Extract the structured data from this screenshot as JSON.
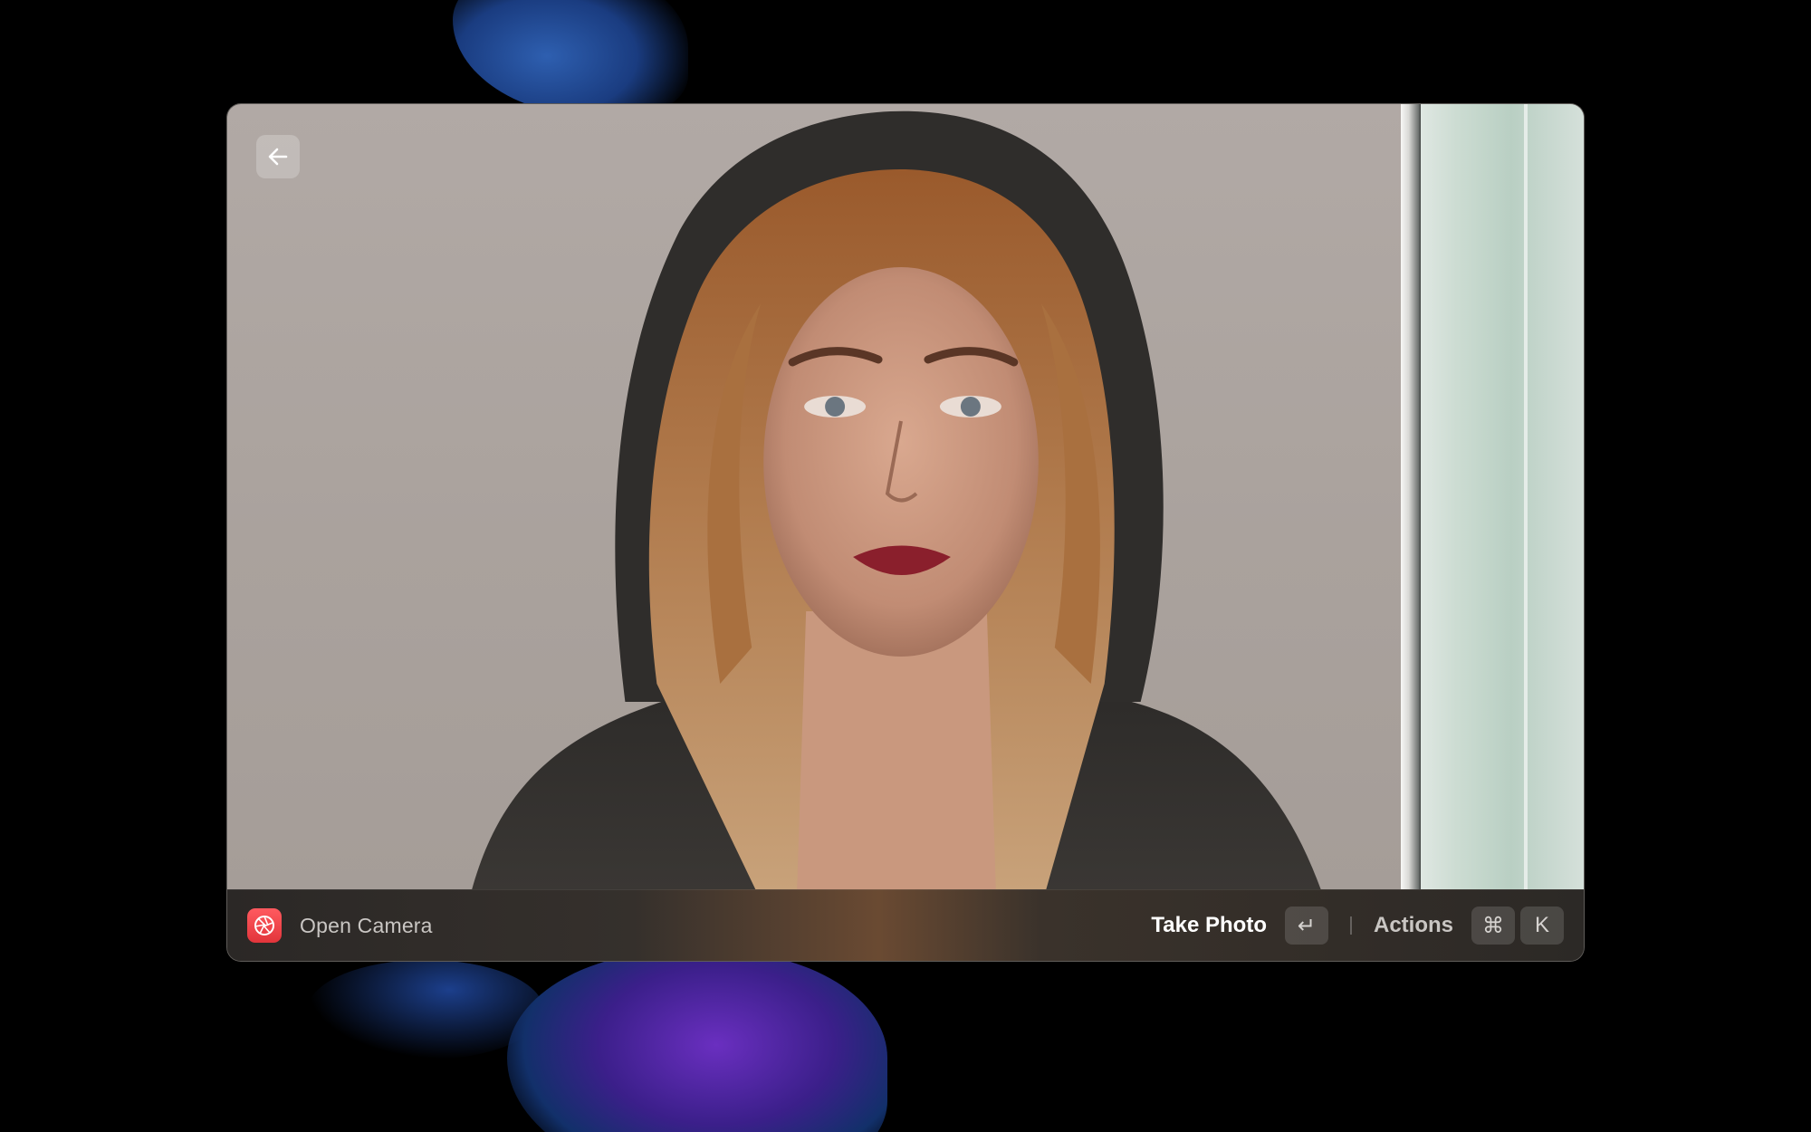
{
  "window": {
    "back_icon": "arrow-left-icon"
  },
  "action_bar": {
    "app_icon": "aperture-icon",
    "app_title": "Open Camera",
    "primary_action": "Take Photo",
    "primary_shortcut": "↵",
    "secondary_action": "Actions",
    "secondary_shortcut_modifier": "⌘",
    "secondary_shortcut_key": "K"
  },
  "colors": {
    "app_icon_red": "#e2353b",
    "background": "#000000"
  }
}
